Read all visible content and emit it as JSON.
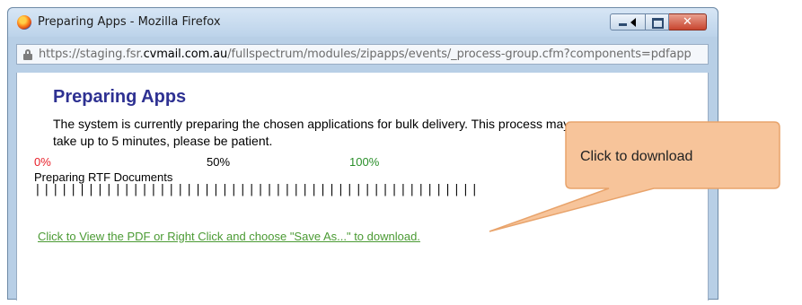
{
  "window": {
    "title": "Preparing Apps - Mozilla Firefox",
    "url_prefix": "https://staging.fsr.",
    "url_domain": "cvmail.com.au",
    "url_suffix": "/fullspectrum/modules/zipapps/events/_process-group.cfm?components=pdfapp",
    "close_label": "✕"
  },
  "page": {
    "heading": "Preparing Apps",
    "description": "The system is currently preparing the chosen applications for bulk delivery. This process may take up to 5 minutes, please be patient.",
    "progress_labels": {
      "start": "0%",
      "mid": "50%",
      "end": "100%"
    },
    "status": "Preparing RTF Documents",
    "progress_bars": "||||||||||||||||||||||||||||||||||||||||||||||||||",
    "download_link": "Click to View the PDF or Right Click and choose \"Save As...\" to download."
  },
  "callout": {
    "text": "Click to download",
    "fill": "#f7c49a",
    "stroke": "#e8a36b"
  }
}
